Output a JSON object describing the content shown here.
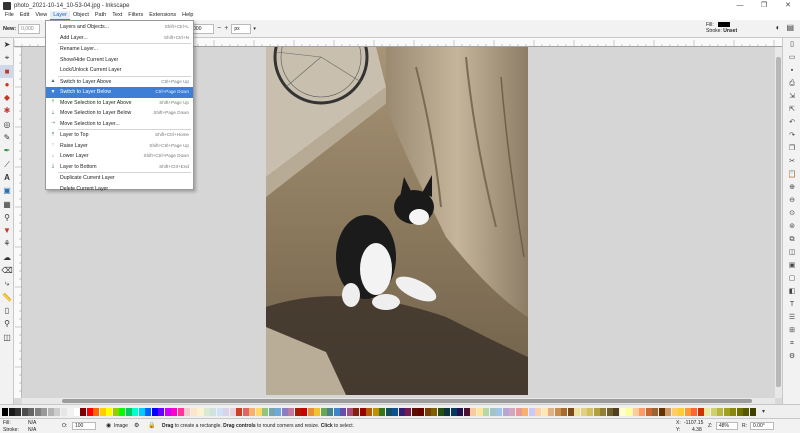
{
  "window": {
    "title": "photo_2021-10-14_10-53-04.jpg - Inkscape",
    "controls": [
      "—",
      "❐",
      "✕"
    ]
  },
  "menubar": [
    "File",
    "Edit",
    "View",
    "Layer",
    "Object",
    "Path",
    "Text",
    "Filters",
    "Extensions",
    "Help"
  ],
  "toolcontrols": {
    "new_label": "New:",
    "w_value": "0,000",
    "field_value": "000",
    "unit": "px"
  },
  "style_indicator": {
    "fill_label": "Fill:",
    "stroke_label": "Stroke:",
    "stroke_value": "Unset",
    "fill_color": "#000000"
  },
  "layer_menu": {
    "items": [
      {
        "label": "Layers and Objects...",
        "shortcut": "Shift+Ctrl+L",
        "icon": "",
        "highlighted": false
      },
      {
        "label": "Add Layer...",
        "shortcut": "Shift+Ctrl+N",
        "icon": "",
        "highlighted": false
      },
      {
        "sep": true
      },
      {
        "label": "Rename Layer...",
        "shortcut": "",
        "icon": "",
        "highlighted": false
      },
      {
        "label": "Show/Hide Current Layer",
        "shortcut": "",
        "icon": "",
        "highlighted": false
      },
      {
        "label": "Lock/Unlock Current Layer",
        "shortcut": "",
        "icon": "",
        "highlighted": false
      },
      {
        "sep": true
      },
      {
        "label": "Switch to Layer Above",
        "shortcut": "Ctrl+Page Up",
        "icon": "layer-up-icon",
        "highlighted": false
      },
      {
        "label": "Switch to Layer Below",
        "shortcut": "Ctrl+Page Down",
        "icon": "layer-down-icon",
        "highlighted": true
      },
      {
        "label": "Move Selection to Layer Above",
        "shortcut": "Shift+Page Up",
        "icon": "move-up-icon",
        "highlighted": false
      },
      {
        "label": "Move Selection to Layer Below",
        "shortcut": "Shift+Page Down",
        "icon": "move-down-icon",
        "highlighted": false
      },
      {
        "label": "Move Selection to Layer...",
        "shortcut": "",
        "icon": "move-to-icon",
        "highlighted": false
      },
      {
        "sep": true
      },
      {
        "label": "Layer to Top",
        "shortcut": "Shift+Ctrl+Home",
        "icon": "layer-top-icon",
        "highlighted": false
      },
      {
        "label": "Raise Layer",
        "shortcut": "Shift+Ctrl+Page Up",
        "icon": "raise-icon",
        "highlighted": false
      },
      {
        "label": "Lower Layer",
        "shortcut": "Shift+Ctrl+Page Down",
        "icon": "lower-icon",
        "highlighted": false
      },
      {
        "label": "Layer to Bottom",
        "shortcut": "Shift+Ctrl+End",
        "icon": "layer-bottom-icon",
        "highlighted": false
      },
      {
        "sep": true
      },
      {
        "label": "Duplicate Current Layer",
        "shortcut": "",
        "icon": "",
        "highlighted": false
      },
      {
        "label": "Delete Current Layer",
        "shortcut": "",
        "icon": "",
        "highlighted": false
      }
    ]
  },
  "palette_colors": [
    "#000000",
    "#1a1a1a",
    "#333333",
    "#4d4d4d",
    "#666666",
    "#808080",
    "#999999",
    "#b3b3b3",
    "#cccccc",
    "#e6e6e6",
    "#f2f2f2",
    "#ffffff",
    "#800000",
    "#ff0000",
    "#ff6600",
    "#ffcc00",
    "#ffff00",
    "#99cc00",
    "#00ff00",
    "#00cc66",
    "#00ffcc",
    "#00ccff",
    "#0066ff",
    "#0000ff",
    "#6600ff",
    "#cc00ff",
    "#ff00cc",
    "#ff3399",
    "#f4cccc",
    "#fce5cd",
    "#fff2cc",
    "#d9ead3",
    "#d0e0e3",
    "#cfe2f3",
    "#d9d2e9",
    "#ead1dc",
    "#cc4125",
    "#e06666",
    "#f6b26b",
    "#ffd966",
    "#93c47d",
    "#76a5af",
    "#6fa8dc",
    "#8e7cc3",
    "#c27ba0",
    "#a61c00",
    "#cc0000",
    "#e69138",
    "#f1c232",
    "#6aa84f",
    "#45818e",
    "#3d85c6",
    "#674ea7",
    "#a64d79",
    "#85200c",
    "#990000",
    "#b45f06",
    "#bf9000",
    "#38761d",
    "#134f5c",
    "#0b5394",
    "#351c75",
    "#741b47",
    "#5b0f00",
    "#660000",
    "#783f04",
    "#7f6000",
    "#274e13",
    "#0c343d",
    "#073763",
    "#20124d",
    "#4c1130",
    "#f9cb9c",
    "#ffe599",
    "#b6d7a8",
    "#a2c4c9",
    "#9fc5e8",
    "#b4a7d6",
    "#d5a6bd",
    "#ea9999",
    "#f6b26b",
    "#c9c9ff",
    "#ffd1a4",
    "#ffe6b3",
    "#e0b084",
    "#c98e4f",
    "#a86b2e",
    "#7a4a1b",
    "#f0e0a0",
    "#e0d080",
    "#d0c060",
    "#b0a040",
    "#90803a",
    "#706030",
    "#504020",
    "#ffffcc",
    "#ffff99",
    "#ffcc99",
    "#ff9966",
    "#cc6633",
    "#996633",
    "#663300",
    "#cc9966",
    "#ffcc66",
    "#ffcc33",
    "#ff9933",
    "#ff6633",
    "#cc3300",
    "#e8e8a0",
    "#d0d070",
    "#b8b840",
    "#a0a020",
    "#888810",
    "#707000",
    "#585800",
    "#404000"
  ],
  "statusbar": {
    "fill_label": "Fill:",
    "stroke_label": "Stroke:",
    "fill_value": "N/A",
    "stroke_value": "N/A",
    "opacity_label": "O:",
    "opacity_value": "100",
    "layer_name": "Image",
    "message_bold1": "Drag",
    "message_1": " to create a rectangle. ",
    "message_bold2": "Drag controls",
    "message_2": " to round corners and resize. ",
    "message_bold3": "Click",
    "message_3": " to select.",
    "x_label": "X:",
    "x_value": "-1107.15",
    "y_label": "Y:",
    "y_value": "4.38",
    "zoom_label": "Z:",
    "zoom_value": "48%",
    "rotation_label": "R:",
    "rotation_value": "0.00°"
  }
}
